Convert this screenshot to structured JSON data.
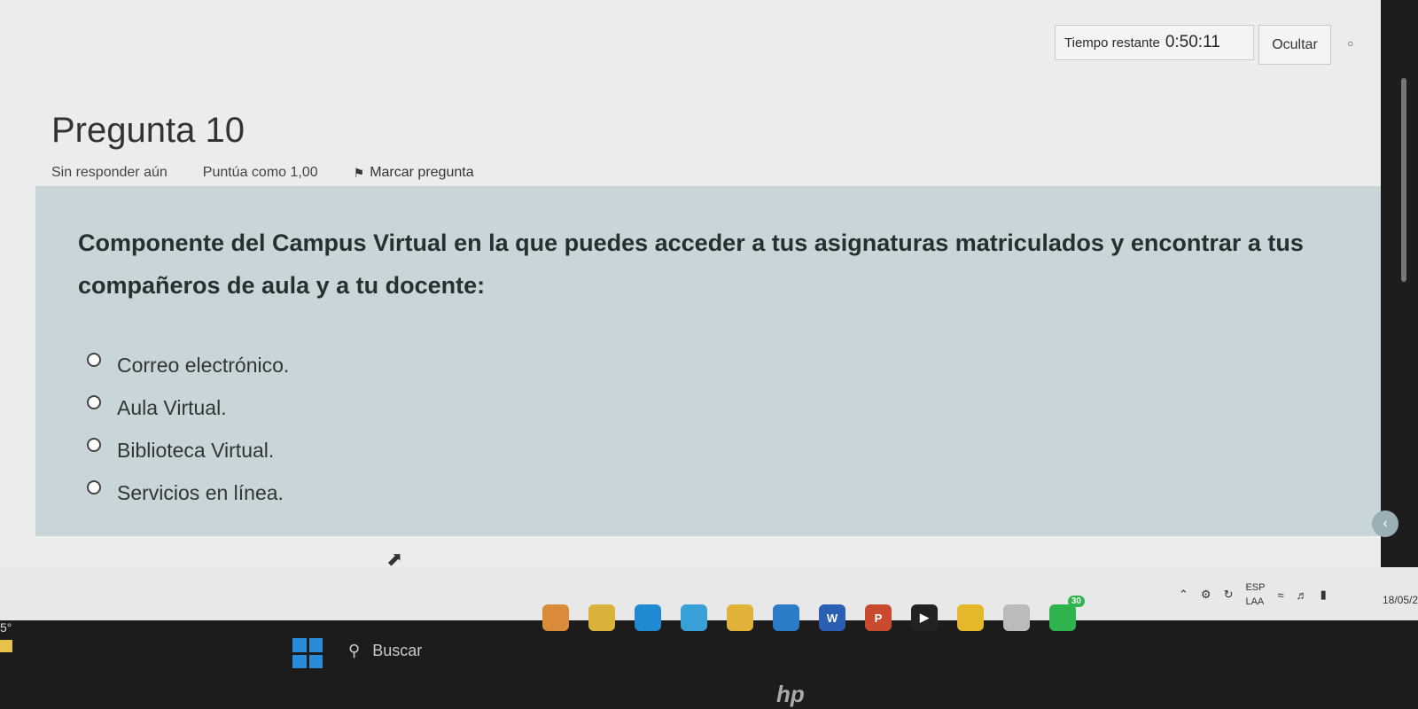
{
  "header": {
    "timer_label": "Tiempo restante",
    "timer_value": "0:50:11",
    "hide_label": "Ocultar"
  },
  "question": {
    "title": "Pregunta 10",
    "status": "Sin responder aún",
    "score": "Puntúa como 1,00",
    "flag_label": "Marcar pregunta",
    "text": "Componente del Campus Virtual en la que puedes acceder a tus asignaturas matriculados y encontrar a tus compañeros de aula y a tu docente:",
    "options": [
      {
        "label": "Correo electrónico."
      },
      {
        "label": "Aula Virtual."
      },
      {
        "label": "Biblioteca Virtual."
      },
      {
        "label": "Servicios en línea."
      }
    ]
  },
  "taskbar": {
    "weather_temp": "5°",
    "search_placeholder": "Buscar",
    "notification_count": "30",
    "lang_primary": "ESP",
    "lang_secondary": "LAA",
    "date": "18/05/2",
    "apps": [
      {
        "name": "widgets-icon",
        "color": "#d98b3a"
      },
      {
        "name": "file-explorer-icon",
        "color": "#d8b23a"
      },
      {
        "name": "edge-icon",
        "color": "#1f8ad2"
      },
      {
        "name": "copilot-icon",
        "color": "#3aa0d8"
      },
      {
        "name": "folder-icon",
        "color": "#e0b23a"
      },
      {
        "name": "store-icon",
        "color": "#2b7bc6"
      },
      {
        "name": "word-icon",
        "color": "#2b5fb3"
      },
      {
        "name": "powerpoint-icon",
        "color": "#c94a2d"
      },
      {
        "name": "media-player-icon",
        "color": "#222"
      },
      {
        "name": "chrome-icon",
        "color": "#e3b82a"
      },
      {
        "name": "settings-icon",
        "color": "#bbb"
      },
      {
        "name": "whatsapp-icon",
        "color": "#2fb34f"
      }
    ]
  },
  "colors": {
    "question_box": "#c9d6d9",
    "page_bg": "#ececec",
    "taskbar": "#1c1c1c"
  }
}
